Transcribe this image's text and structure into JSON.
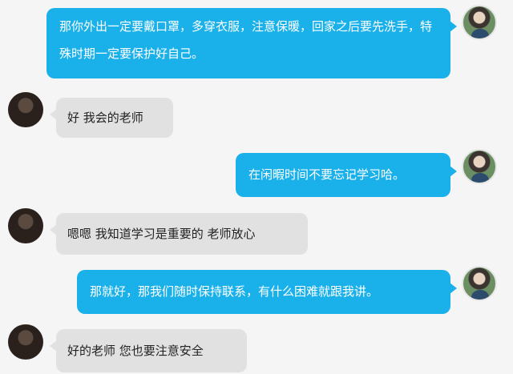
{
  "messages": [
    {
      "sender": "teacher",
      "text": "那你外出一定要戴口罩，多穿衣服，注意保暖，回家之后要先洗手，特殊时期一定要保护好自己。"
    },
    {
      "sender": "student",
      "text": "好 我会的老师"
    },
    {
      "sender": "teacher",
      "text": "在闲暇时间不要忘记学习哈。"
    },
    {
      "sender": "student",
      "text": "嗯嗯 我知道学习是重要的 老师放心"
    },
    {
      "sender": "teacher",
      "text": "那就好，那我们随时保持联系，有什么困难就跟我讲。"
    },
    {
      "sender": "student",
      "text": "好的老师 您也要注意安全"
    }
  ],
  "colors": {
    "teacher_bubble": "#1ab1eb",
    "student_bubble": "#e1e1e1",
    "background": "#f5f5f5"
  }
}
